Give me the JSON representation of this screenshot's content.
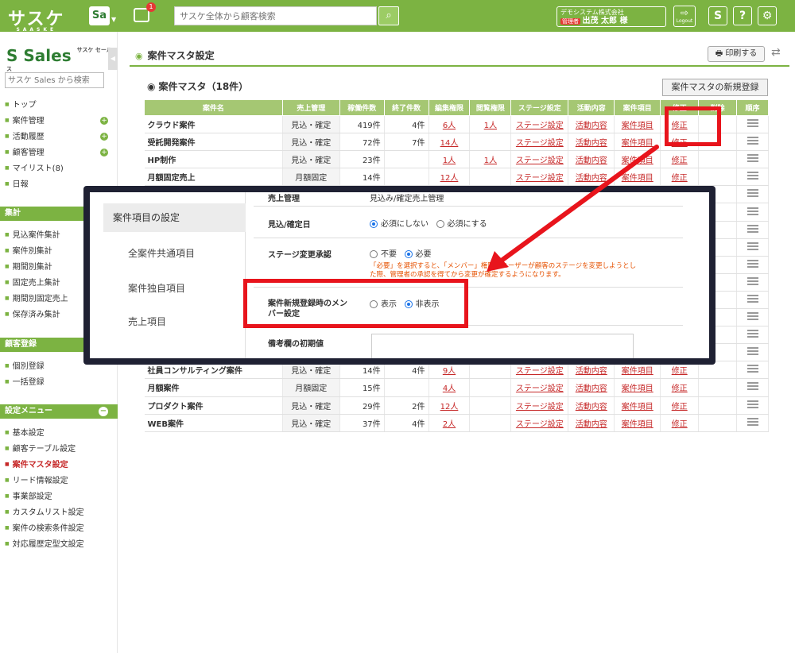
{
  "header": {
    "logo": "サスケ",
    "logo_sub": "SAASKE",
    "app_badge": "Sa",
    "notice_count": "1",
    "search_placeholder": "サスケ全体から顧客検索",
    "company": "デモシステム株式会社",
    "role": "管理者",
    "user": "出茂 太郎 様",
    "logout": "Logout"
  },
  "sidebar": {
    "logo": "Sales",
    "logo_sup": "サスケ セールス",
    "search_placeholder": "サスケ Sales から検索",
    "main_items": [
      {
        "label": "トップ"
      },
      {
        "label": "案件管理"
      },
      {
        "label": "活動履歴"
      },
      {
        "label": "顧客管理"
      },
      {
        "label": "マイリスト(8)"
      },
      {
        "label": "日報"
      }
    ],
    "agg_head": "集計",
    "agg_items": [
      "見込案件集計",
      "案件別集計",
      "期間別集計",
      "固定売上集計",
      "期間別固定売上",
      "保存済み集計"
    ],
    "reg_head": "顧客登録",
    "reg_items": [
      "個別登録",
      "一括登録"
    ],
    "set_head": "設定メニュー",
    "set_items": [
      "基本設定",
      "顧客テーブル設定",
      "案件マスタ設定",
      "リード情報設定",
      "事業部設定",
      "カスタムリスト設定",
      "案件の検索条件設定",
      "対応履歴定型文設定"
    ]
  },
  "main": {
    "page_title": "案件マスタ設定",
    "print": "印刷する",
    "section_title": "案件マスタ（18件）",
    "new_button": "案件マスタの新規登録",
    "columns": [
      "案件名",
      "売上管理",
      "稼働件数",
      "終了件数",
      "編集権限",
      "閲覧権限",
      "ステージ設定",
      "活動内容",
      "案件項目",
      "修正",
      "削除",
      "順序"
    ],
    "rows": [
      {
        "name": "クラウド案件",
        "sales": "見込・確定",
        "active": "419件",
        "done": "4件",
        "edit": "6人",
        "view": "1人"
      },
      {
        "name": "受託開発案件",
        "sales": "見込・確定",
        "active": "72件",
        "done": "7件",
        "edit": "14人",
        "view": ""
      },
      {
        "name": "HP制作",
        "sales": "見込・確定",
        "active": "23件",
        "done": "",
        "edit": "1人",
        "view": "1人"
      },
      {
        "name": "月額固定売上",
        "sales": "月額固定",
        "active": "14件",
        "done": "",
        "edit": "12人",
        "view": ""
      }
    ],
    "rows_bottom": [
      {
        "name": "社員コンサルティング案件",
        "sales": "見込・確定",
        "active": "14件",
        "done": "4件",
        "edit": "9人",
        "view": ""
      },
      {
        "name": "月額案件",
        "sales": "月額固定",
        "active": "15件",
        "done": "",
        "edit": "4人",
        "view": ""
      },
      {
        "name": "プロダクト案件",
        "sales": "見込・確定",
        "active": "29件",
        "done": "2件",
        "edit": "12人",
        "view": ""
      },
      {
        "name": "WEB案件",
        "sales": "見込・確定",
        "active": "37件",
        "done": "4件",
        "edit": "2人",
        "view": ""
      }
    ],
    "link_stage": "ステージ設定",
    "link_activity": "活動内容",
    "link_items": "案件項目",
    "link_edit": "修正"
  },
  "popup": {
    "nav_head": "案件項目の設定",
    "nav_items": [
      "全案件共通項目",
      "案件独自項目",
      "売上項目"
    ],
    "rows": {
      "sales_label": "売上管理",
      "sales_value": "見込み/確定売上管理",
      "date_label": "見込/確定日",
      "date_opt1": "必須にしない",
      "date_opt2": "必須にする",
      "stage_label": "ステージ変更承認",
      "stage_opt1": "不要",
      "stage_opt2": "必要",
      "stage_note1": "「必要」を選択すると、「メンバー」権限のユーザーが顧客のステージを変更しようとし",
      "stage_note2": "た際、管理者の承認を得てから変更が確定するようになります。",
      "member_label1": "案件新規登録時のメン",
      "member_label2": "バー設定",
      "member_opt1": "表示",
      "member_opt2": "非表示",
      "memo_label": "備考欄の初期値"
    }
  },
  "colors": {
    "brand": "#7cb342",
    "highlight": "#e8141c"
  }
}
